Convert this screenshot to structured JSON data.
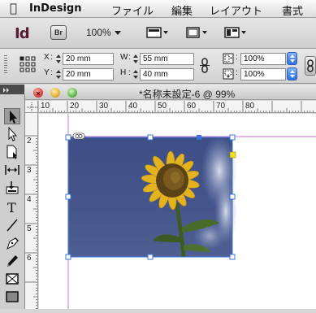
{
  "menubar": {
    "app_name": "InDesign",
    "items": [
      "ファイル",
      "編集",
      "レイアウト",
      "書式"
    ]
  },
  "appbar": {
    "logo": "Id",
    "bridge_label": "Br",
    "zoom_value": "100%"
  },
  "control": {
    "x_label": "X",
    "x_value": "20 mm",
    "y_label": "Y",
    "y_value": "20 mm",
    "w_label": "W",
    "w_value": "55 mm",
    "h_label": "H",
    "h_value": "40 mm",
    "scale_x_value": "100%",
    "scale_y_value": "100%"
  },
  "document": {
    "title": "*名称未設定-6 @ 99%",
    "h_ruler_labels": [
      "10",
      "20",
      "30",
      "40",
      "50",
      "60",
      "70",
      "80"
    ],
    "v_ruler_labels": [
      "2",
      "3",
      "4",
      "5",
      "6"
    ]
  },
  "icons": {
    "selection": "selection-tool-icon",
    "direct_selection": "direct-selection-tool-icon",
    "page": "page-tool-icon",
    "gap": "gap-tool-icon",
    "content_collector": "content-collector-icon",
    "type": "type-tool-icon",
    "line": "line-tool-icon",
    "pen": "pen-tool-icon",
    "pencil": "pencil-tool-icon",
    "rect_frame": "rectangle-frame-tool-icon",
    "rectangle": "rectangle-tool-icon"
  },
  "colors": {
    "accent_blue": "#2d6fe0",
    "selection_blue": "#3a74d8",
    "margin_magenta": "#c57ad0",
    "close_red": "#e0443e",
    "minimize_yellow": "#e2b23a",
    "zoom_green": "#62b94a"
  }
}
